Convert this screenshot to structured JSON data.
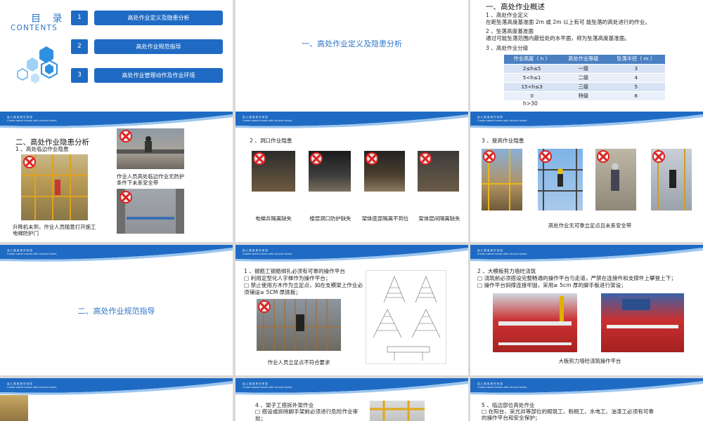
{
  "banner": {
    "line1": "高 心 楼 盘 美 好 家 园",
    "line2": "Create sweet homes with sincere hearts"
  },
  "toc": {
    "title": "目 录",
    "subtitle": "CONTENTS",
    "items": [
      {
        "num": "1",
        "label": "高处作业定义及隐患分析"
      },
      {
        "num": "2",
        "label": "高处作业规范指导"
      },
      {
        "num": "3",
        "label": "高处作业管理动作及作业环境"
      }
    ]
  },
  "section1": {
    "title": "一、高处作业定义及隐患分析"
  },
  "overview": {
    "heading": "一、高处作业概述",
    "p1_title": "1 、高处作业定义",
    "p1_text": "在距坠落高度基准面 2m 或 2m 以上有可 能坠落的高处进行的作业。",
    "p2_title": "2 、坠落高度基准面",
    "p2_text": "通过可能坠落范围内最低处的水平面，称为坠落高度基准面。",
    "p3_title": "3 、高处作业分级",
    "table": {
      "headers": [
        "作业高度（ h ）",
        "高处作业等级",
        "坠落半径（ m ）"
      ],
      "rows": [
        [
          "2≤h≤5",
          "一级",
          "3"
        ],
        [
          "5<h≤1",
          "二级",
          "4"
        ],
        [
          "15<h≤3",
          "三级",
          "5"
        ],
        [
          "0",
          "特级",
          "6"
        ]
      ],
      "extra": "h>30"
    }
  },
  "hazards": {
    "heading": "二、高处作业隐患分析",
    "sub": "1 、高处临边作业隐患",
    "cap_right": "作业人员高处临边作业无防护条件下未系安全带",
    "cap_left": "升降机未到，作业人员随意打开施工电梯防护门"
  },
  "openings": {
    "sub": "2 、洞口作业隐患",
    "captions": [
      "电梯井隔离缺失",
      "楼层洞口防护缺失",
      "架体底部隔离不到位",
      "架体层间隔离缺失"
    ]
  },
  "climbing": {
    "sub": "3 、登高作业隐患",
    "caption": "高处作业无可靠立足点且未系安全带"
  },
  "section2": {
    "title": "二、高处作业规范指导"
  },
  "rebar": {
    "p1": "1 、钢筋工钢筋绑扎必须有可靠的操作平台",
    "p2": "□ 利用定型化人字梯作为操作平台；",
    "p3": "□ 禁止使用方木作为立足点，如在支模架上作业必须铺设≥ 5CM 厚挑板；",
    "caption": "作业人员立足点不符合要求"
  },
  "formwork": {
    "p1": "2 、大模板剪力墙砼浇筑",
    "p2": "□ 浇筑前必须搭设完整畅通的操作平台与走道，严禁在连接件和支撑件上攀登上下；",
    "p3": "□ 操作平台斜撑连接牢固，采用≥ 5cm 厚的脚手板进行架设；",
    "caption": "大板剪力墙砼浇筑操作平台"
  },
  "scaffold": {
    "p1": "4 、架子工搭拆外架作业",
    "p2": "□ 搭设或拆除脚手架前必须进行危险作业审批；"
  },
  "edge": {
    "p1": "5 、临边部位高处作业",
    "p2": "□ 在阳台、采光井等部位的砌筑工、粉刷工、水电工、油漆工必须有可靠",
    "p3": "的操作平台和安全保护；"
  },
  "colors": {
    "accent": "#1f6bc4",
    "text_blue": "#2f75c9",
    "danger": "#dd2222"
  }
}
